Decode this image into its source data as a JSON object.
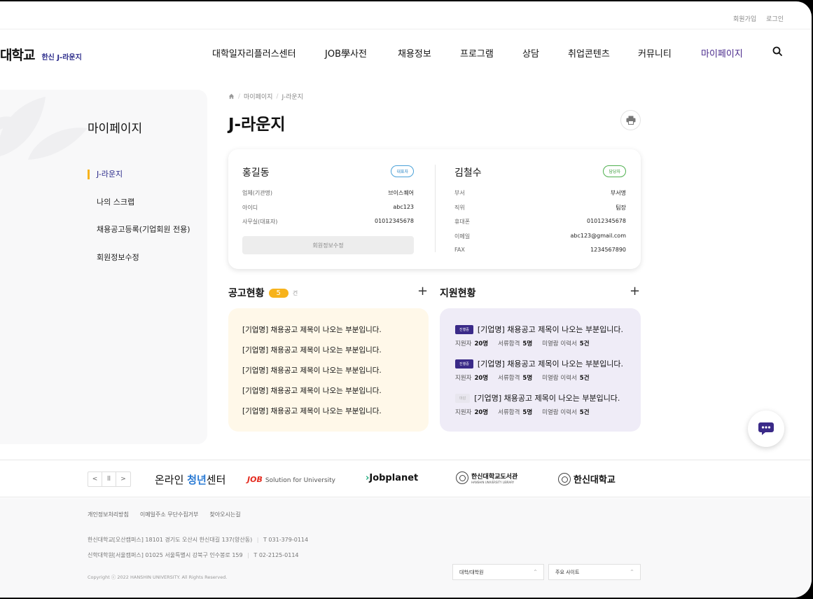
{
  "util": {
    "join": "회원가입",
    "login": "로그인"
  },
  "header": {
    "logo_main": "대학교",
    "logo_sub": "한신 J-라운지",
    "nav": [
      {
        "label": "대학일자리플러스센터",
        "w": 161
      },
      {
        "label": "JOB學사전",
        "w": 104
      },
      {
        "label": "채용정보",
        "w": 89
      },
      {
        "label": "프로그램",
        "w": 89
      },
      {
        "label": "상담",
        "w": 65
      },
      {
        "label": "취업콘텐츠",
        "w": 100
      },
      {
        "label": "커뮤니티",
        "w": 90
      },
      {
        "label": "마이페이지",
        "w": 80,
        "active": true
      }
    ]
  },
  "sidebar": {
    "title": "마이페이지",
    "items": [
      {
        "label": "J-라운지",
        "active": true
      },
      {
        "label": "나의 스크랩"
      },
      {
        "label": "채용공고등록(기업회원 전용)"
      },
      {
        "label": "회원정보수정"
      }
    ]
  },
  "breadcrumb": {
    "home": "home",
    "level1": "마이페이지",
    "level2": "J-라운지"
  },
  "page_title": "J-라운지",
  "profile": {
    "representative": {
      "name": "홍길동",
      "badge": "대표자",
      "rows": [
        {
          "k": "업체(기관명)",
          "v": "브이스퀘어"
        },
        {
          "k": "아이디",
          "v": "abc123"
        },
        {
          "k": "사무실(대표자)",
          "v": "01012345678"
        }
      ],
      "edit_label": "회원정보수정"
    },
    "manager": {
      "name": "김철수",
      "badge": "담당자",
      "rows": [
        {
          "k": "부서",
          "v": "부서명"
        },
        {
          "k": "직위",
          "v": "팀장"
        },
        {
          "k": "휴대폰",
          "v": "01012345678"
        },
        {
          "k": "이메일",
          "v": "abc123@gmail.com"
        },
        {
          "k": "FAX",
          "v": "1234567890"
        }
      ]
    }
  },
  "posts": {
    "title": "공고현황",
    "count": "5",
    "unit": "건",
    "items": [
      "[기업명] 채용공고 제목이 나오는 부분입니다.",
      "[기업명] 채용공고 제목이 나오는 부분입니다.",
      "[기업명] 채용공고 제목이 나오는 부분입니다.",
      "[기업명] 채용공고 제목이 나오는 부분입니다.",
      "[기업명] 채용공고 제목이 나오는 부분입니다."
    ]
  },
  "applications": {
    "title": "지원현황",
    "labels": {
      "applicants": "지원자",
      "passed": "서류합격",
      "unread": "미열람 이력서"
    },
    "items": [
      {
        "status": "진행중",
        "status_type": "active",
        "title": "[기업명] 채용공고 제목이 나오는 부분입니다.",
        "applicants": "20명",
        "passed": "5명",
        "unread": "5건"
      },
      {
        "status": "진행중",
        "status_type": "active",
        "title": "[기업명] 채용공고 제목이 나오는 부분입니다.",
        "applicants": "20명",
        "passed": "5명",
        "unread": "5건"
      },
      {
        "status": "마감",
        "status_type": "closed",
        "title": "[기업명] 채용공고 제목이 나오는 부분입니다.",
        "applicants": "20명",
        "passed": "5명",
        "unread": "5건"
      }
    ]
  },
  "partners": {
    "p1_a": "온라인",
    "p1_b": "청년",
    "p1_c": "센터",
    "p2_a": "JOB",
    "p2_b": "Solution for University",
    "p3": "Jobplanet",
    "p4": "한신대학교도서관",
    "p4_small": "HANSHIN UNIVERSITY LIBRARY",
    "p5": "한신대학교"
  },
  "footer": {
    "links": [
      "개인정보처리방침",
      "이메일주소 무단수집거부",
      "찾아오시는길"
    ],
    "addr1_name": "한신대학교[오산캠퍼스]",
    "addr1": "18101 경기도 오산시 한신대길 137(양산동)",
    "addr1_tel": "T 031-379-0114",
    "addr2_name": "신학대학원[서울캠퍼스]",
    "addr2": "01025 서울특별시 강북구 인수봉로 159",
    "addr2_tel": "T 02-2125-0114",
    "copyright": "Copyright ⓒ 2022 HANSHIN UNIVERSITY. All Rights Reserved.",
    "select1": "대학/대학원",
    "select2": "주요 사이트"
  },
  "colors": {
    "accent": "#f7b31c",
    "brand": "#3a2a88",
    "nav_active": "#4a2a8c"
  }
}
